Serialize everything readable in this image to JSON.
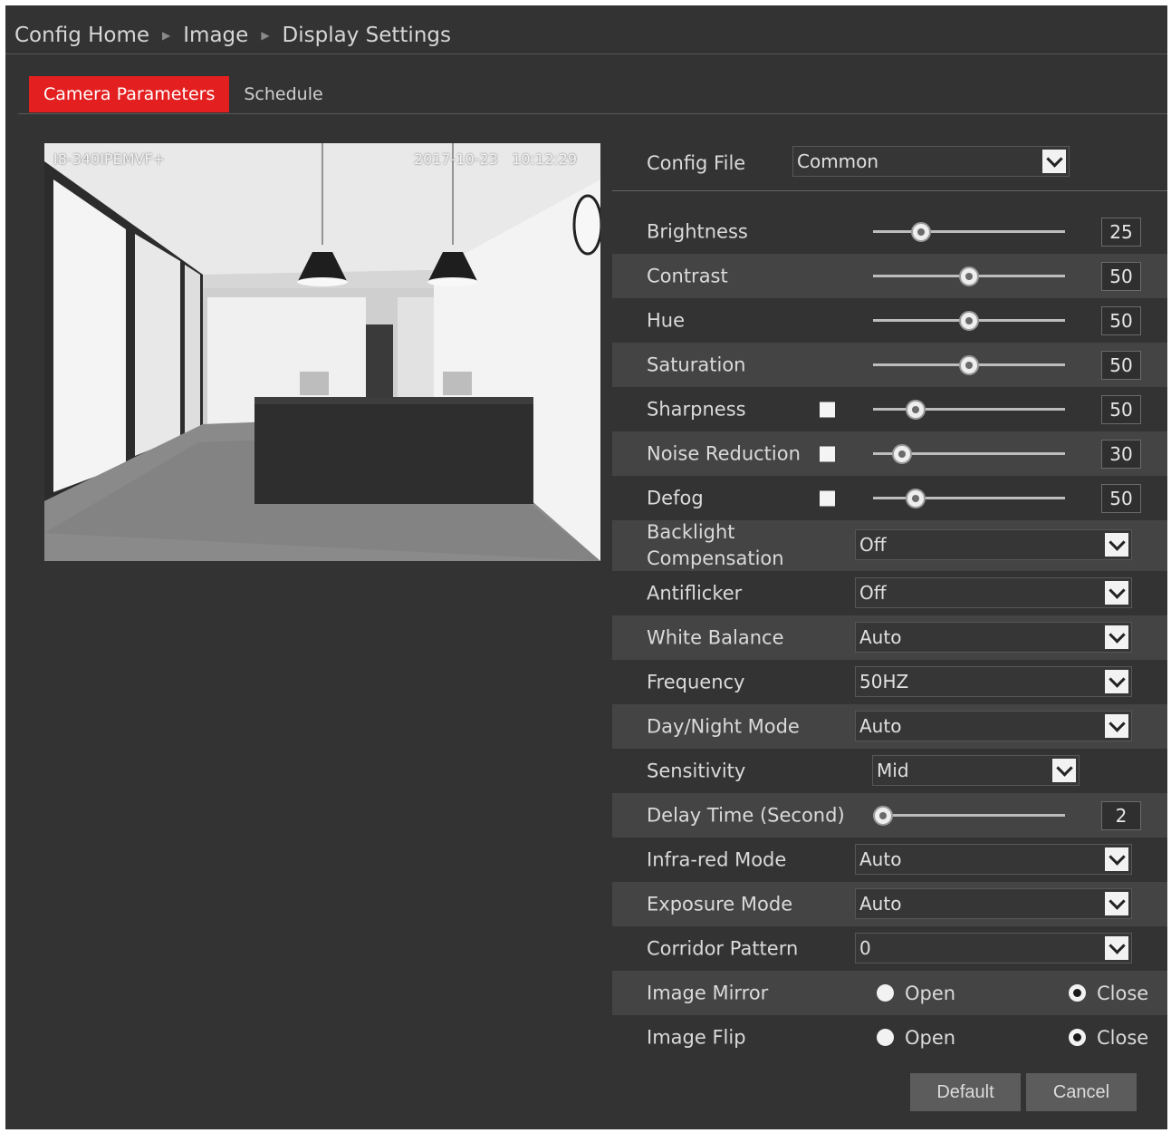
{
  "breadcrumb": {
    "items": [
      "Config Home",
      "Image",
      "Display Settings"
    ]
  },
  "tabs": [
    {
      "label": "Camera Parameters",
      "active": true
    },
    {
      "label": "Schedule",
      "active": false
    }
  ],
  "preview": {
    "camera_name": "I8-340IPEMVF+",
    "date": "2017-10-23",
    "time": "10:12:29"
  },
  "config_file": {
    "label": "Config File",
    "value": "Common"
  },
  "settings": {
    "brightness": {
      "label": "Brightness",
      "value": "25",
      "level": 25
    },
    "contrast": {
      "label": "Contrast",
      "value": "50",
      "level": 50
    },
    "hue": {
      "label": "Hue",
      "value": "50",
      "level": 50
    },
    "saturation": {
      "label": "Saturation",
      "value": "50",
      "level": 50
    },
    "sharpness": {
      "label": "Sharpness",
      "value": "50",
      "level": 22
    },
    "noise_reduction": {
      "label": "Noise Reduction",
      "value": "30",
      "level": 15
    },
    "defog": {
      "label": "Defog",
      "value": "50",
      "level": 22
    },
    "backlight": {
      "label": "Backlight Compensation",
      "value": "Off"
    },
    "antiflicker": {
      "label": "Antiflicker",
      "value": "Off"
    },
    "white_balance": {
      "label": "White Balance",
      "value": "Auto"
    },
    "frequency": {
      "label": "Frequency",
      "value": "50HZ"
    },
    "day_night": {
      "label": "Day/Night Mode",
      "value": "Auto"
    },
    "sensitivity": {
      "label": "Sensitivity",
      "value": "Mid"
    },
    "delay_time": {
      "label": "Delay Time (Second)",
      "value": "2",
      "level": 5
    },
    "infrared": {
      "label": "Infra-red Mode",
      "value": "Auto"
    },
    "exposure": {
      "label": "Exposure Mode",
      "value": "Auto"
    },
    "corridor": {
      "label": "Corridor Pattern",
      "value": "0"
    },
    "image_mirror": {
      "label": "Image Mirror",
      "open": "Open",
      "close": "Close",
      "selected": "Close"
    },
    "image_flip": {
      "label": "Image Flip",
      "open": "Open",
      "close": "Close",
      "selected": "Close"
    }
  },
  "buttons": {
    "default": "Default",
    "cancel": "Cancel"
  },
  "colors": {
    "accent": "#e41f1f",
    "background": "#333333",
    "row_alt": "#444444"
  }
}
